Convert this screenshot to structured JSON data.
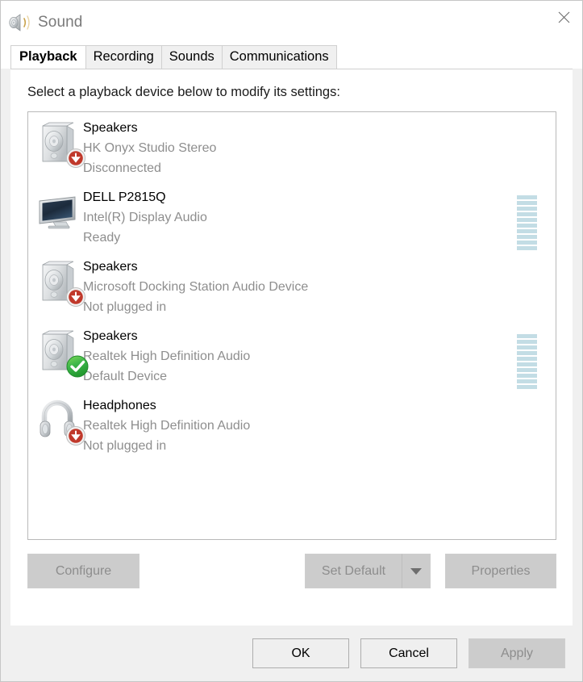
{
  "window": {
    "title": "Sound",
    "icon": "speaker-icon",
    "close_label": "✕"
  },
  "tabs": [
    {
      "label": "Playback",
      "selected": true
    },
    {
      "label": "Recording",
      "selected": false
    },
    {
      "label": "Sounds",
      "selected": false
    },
    {
      "label": "Communications",
      "selected": false
    }
  ],
  "playback": {
    "instruction": "Select a playback device below to modify its settings:",
    "devices": [
      {
        "name": "Speakers",
        "driver": "HK Onyx Studio Stereo",
        "status": "Disconnected",
        "icon": "speaker-box-icon",
        "badge": "red-down-arrow-badge",
        "meter": false,
        "meter_segments": 0
      },
      {
        "name": "DELL P2815Q",
        "driver": "Intel(R) Display Audio",
        "status": "Ready",
        "icon": "monitor-icon",
        "badge": "none",
        "meter": true,
        "meter_segments": 10
      },
      {
        "name": "Speakers",
        "driver": "Microsoft Docking Station Audio Device",
        "status": "Not plugged in",
        "icon": "speaker-box-icon",
        "badge": "red-down-arrow-badge",
        "meter": false,
        "meter_segments": 0
      },
      {
        "name": "Speakers",
        "driver": "Realtek High Definition Audio",
        "status": "Default Device",
        "icon": "speaker-box-icon",
        "badge": "green-check-badge",
        "meter": true,
        "meter_segments": 10
      },
      {
        "name": "Headphones",
        "driver": "Realtek High Definition Audio",
        "status": "Not plugged in",
        "icon": "headphones-icon",
        "badge": "red-down-arrow-badge",
        "meter": false,
        "meter_segments": 0
      }
    ]
  },
  "buttons": {
    "configure": "Configure",
    "set_default": "Set Default",
    "set_default_arrow": "chevron-down-icon",
    "properties": "Properties",
    "ok": "OK",
    "cancel": "Cancel",
    "apply": "Apply"
  },
  "colors": {
    "meter_segment": "#c3dde5",
    "badge_red": "#c0392b",
    "badge_green": "#3cb54a",
    "title_text": "#7a7a7a",
    "secondary_text": "#8e8e8e"
  }
}
